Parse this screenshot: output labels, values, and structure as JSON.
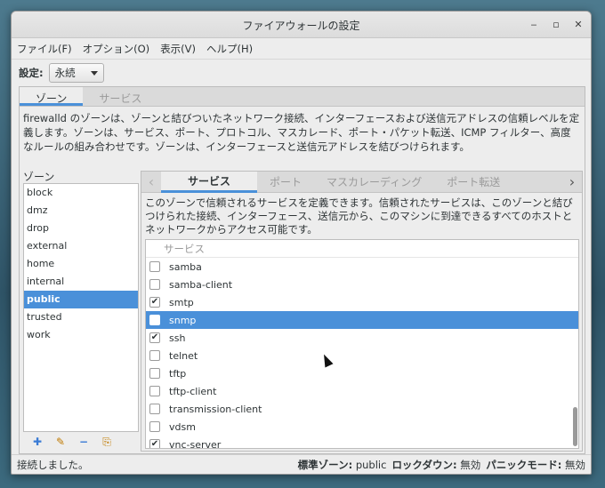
{
  "window": {
    "title": "ファイアウォールの設定"
  },
  "menubar": {
    "items": [
      "ファイル(F)",
      "オプション(O)",
      "表示(V)",
      "ヘルプ(H)"
    ]
  },
  "config": {
    "label": "設定:",
    "value": "永続"
  },
  "outer_tabs": [
    "ゾーン",
    "サービス"
  ],
  "zone_description": "firewalld のゾーンは、ゾーンと結びついたネットワーク接続、インターフェースおよび送信元アドレスの信頼レベルを定義します。ゾーンは、サービス、ポート、プロトコル、マスカレード、ポート・パケット転送、ICMP フィルター、高度なルールの組み合わせです。ゾーンは、インターフェースと送信元アドレスを結びつけられます。",
  "zones": {
    "label": "ゾーン",
    "items": [
      "block",
      "dmz",
      "drop",
      "external",
      "home",
      "internal",
      "public",
      "trusted",
      "work"
    ],
    "selected": "public"
  },
  "inner_tabs": [
    "サービス",
    "ポート",
    "マスカレーディング",
    "ポート転送"
  ],
  "services_description": "このゾーンで信頼されるサービスを定義できます。信頼されたサービスは、このゾーンと結びつけられた接続、インターフェース、送信元から、このマシンに到達できるすべてのホストとネットワークからアクセス可能です。",
  "services": {
    "header": "サービス",
    "rows": [
      {
        "name": "samba",
        "checked": false
      },
      {
        "name": "samba-client",
        "checked": false
      },
      {
        "name": "smtp",
        "checked": true
      },
      {
        "name": "snmp",
        "checked": false,
        "selected": true
      },
      {
        "name": "ssh",
        "checked": true
      },
      {
        "name": "telnet",
        "checked": false
      },
      {
        "name": "tftp",
        "checked": false
      },
      {
        "name": "tftp-client",
        "checked": false
      },
      {
        "name": "transmission-client",
        "checked": false
      },
      {
        "name": "vdsm",
        "checked": false
      },
      {
        "name": "vnc-server",
        "checked": true
      }
    ]
  },
  "status": {
    "message": "接続しました。",
    "default_zone_label": "標準ゾーン:",
    "default_zone_value": "public",
    "lockdown_label": "ロックダウン:",
    "lockdown_value": "無効",
    "panic_label": "パニックモード:",
    "panic_value": "無効"
  },
  "colors": {
    "accent": "#4a90d9"
  }
}
